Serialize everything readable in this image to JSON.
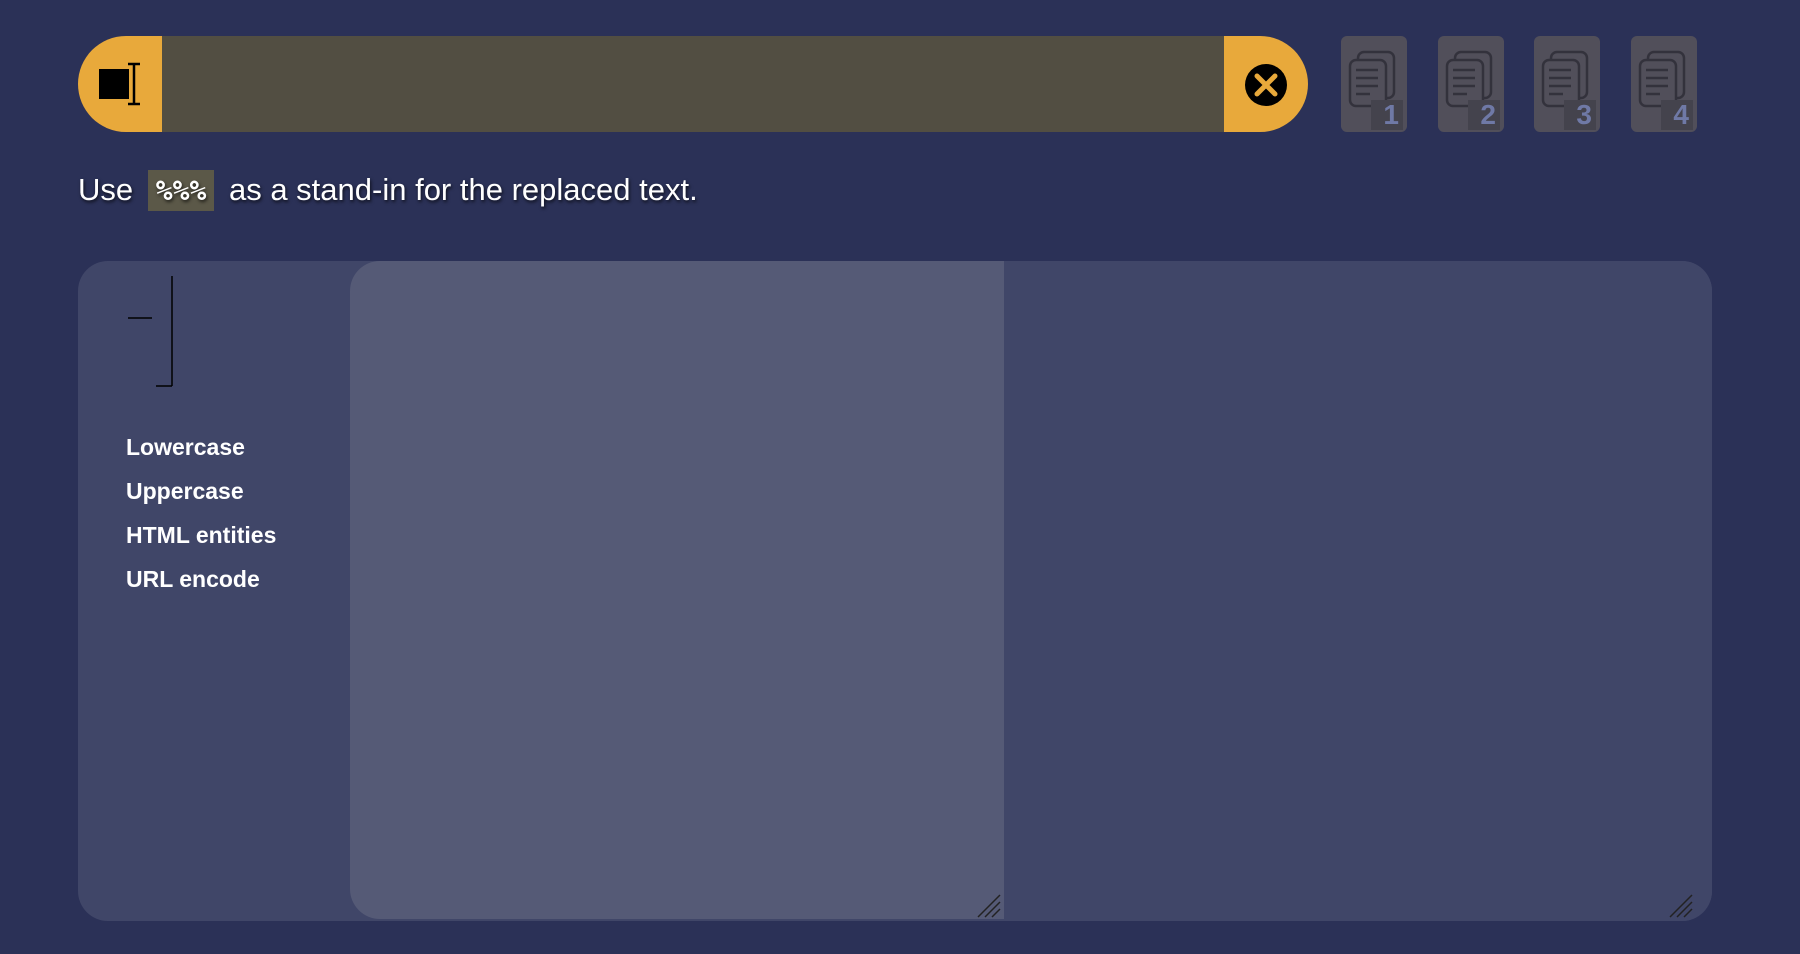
{
  "search": {
    "value": "",
    "placeholder": "",
    "mode_icon": "text-cursor-icon",
    "clear_icon": "close-circle-icon"
  },
  "clipboards": [
    {
      "label": "1",
      "icon": "copy-icon"
    },
    {
      "label": "2",
      "icon": "copy-icon"
    },
    {
      "label": "3",
      "icon": "copy-icon"
    },
    {
      "label": "4",
      "icon": "copy-icon"
    }
  ],
  "hint": {
    "before": "Use",
    "token": "%%%",
    "after": "as a stand-in for the replaced text."
  },
  "transforms": [
    "Lowercase",
    "Uppercase",
    "HTML entities",
    "URL encode"
  ],
  "editor": {
    "input_value": "",
    "output_value": ""
  },
  "colors": {
    "background": "#2b3157",
    "accent": "#e8a93b",
    "input_field": "#524e42",
    "panel": "#404668",
    "editor": "#555a76"
  }
}
